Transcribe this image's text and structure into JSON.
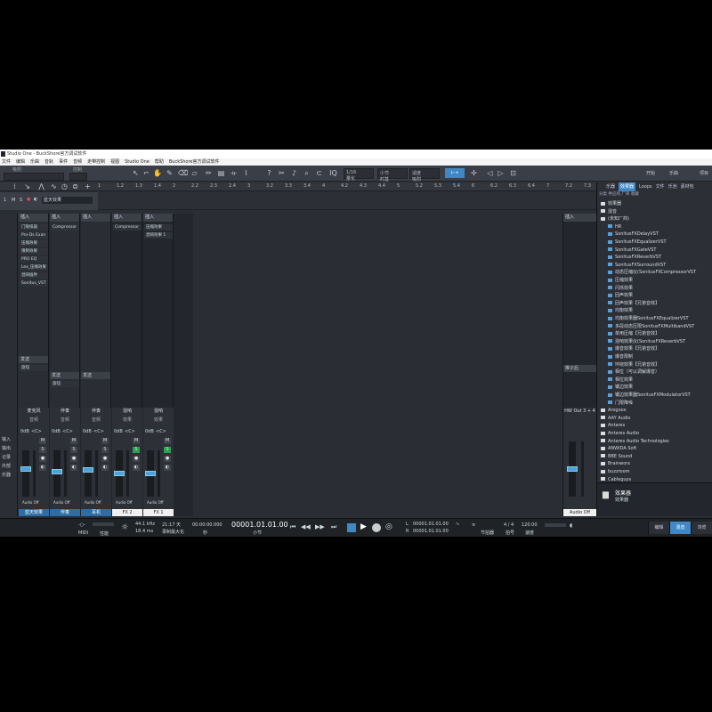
{
  "app": {
    "title": "Studio One - BuckShore官方调试软件",
    "menu": [
      "文件",
      "编辑",
      "乐曲",
      "音轨",
      "事件",
      "音频",
      "走带控制",
      "视图",
      "Studio One",
      "帮助",
      "BuckShore官方调试软件"
    ]
  },
  "toolbar": {
    "label_snap": "吸附",
    "label_control": "控制",
    "quant_value": "1/16",
    "quant_label": "量化",
    "timebase_value": "小节",
    "timebase_label": "时基",
    "snap_value": "适度",
    "snap_label": "吸附",
    "right_buttons": [
      "开始",
      "乐曲",
      "项目"
    ]
  },
  "ruler": {
    "ticks": [
      "1",
      "1.2",
      "1.3",
      "1.4",
      "2",
      "2.2",
      "2.3",
      "2.4",
      "3",
      "3.2",
      "3.3",
      "3.4",
      "4",
      "4.2",
      "4.3",
      "4.4",
      "5",
      "5.2",
      "5.3",
      "5.4",
      "6",
      "6.2",
      "6.3",
      "6.4",
      "7",
      "7.2",
      "7.3"
    ]
  },
  "track": {
    "number": "1",
    "name": "蓝天效果"
  },
  "mixer": {
    "channels": [
      {
        "header": "插入",
        "slots": [
          "门限排器",
          "Pro-Ds Exan",
          "压缩效果",
          "限制效果",
          "PRO EQ",
          "Lex_压缩效果",
          "混响插件",
          "Sonitus_VST"
        ],
        "send_header": "发送",
        "sends": [
          "旋钮"
        ],
        "label": "麦克风",
        "sublabel": "音频",
        "gain": "0dB",
        "pan": "<C>",
        "level": 0.6,
        "foot": "蓝天效果",
        "foot_selected": true,
        "input": "Audio Off"
      },
      {
        "header": "插入",
        "slots": [
          "Compressor"
        ],
        "send_header": "发送",
        "sends": [
          "旋钮"
        ],
        "label": "伴奏",
        "sublabel": "音频",
        "gain": "0dB",
        "pan": "<C>",
        "level": 0.55,
        "foot": "伴奏",
        "foot_selected": true,
        "input": "Audio Off"
      },
      {
        "header": "插入",
        "slots": [],
        "send_header": "发送",
        "sends": [],
        "label": "伴奏",
        "sublabel": "音频",
        "gain": "0dB",
        "pan": "<C>",
        "level": 0.58,
        "foot": "耳机",
        "foot_selected": true,
        "input": "Audio Off"
      },
      {
        "header": "插入",
        "slots": [
          "Compressor"
        ],
        "send_header": "",
        "sends": [],
        "label": "混响",
        "sublabel": "效果",
        "gain": "0dB",
        "pan": "<C>",
        "level": 0.5,
        "foot": "FX 2",
        "foot_selected": false,
        "input": "Audio Off"
      },
      {
        "header": "插入",
        "slots": [
          "压缩效果",
          "混响效果 1"
        ],
        "send_header": "",
        "sends": [],
        "label": "混响",
        "sublabel": "效果",
        "gain": "0dB",
        "pan": "<C>",
        "level": 0.5,
        "foot": "FX 1",
        "foot_selected": false,
        "input": "Audio Off"
      }
    ],
    "left_nav": [
      "输入",
      "输出",
      "记录",
      "外部",
      "乐器"
    ],
    "hw_header": "插入",
    "hw_send": "推子后",
    "hw_label": "HW Out 3 + 4",
    "hw_foot": "Audio Off"
  },
  "browser": {
    "tabs": [
      "乐器",
      "效果器",
      "Loops",
      "文件",
      "乐池",
      "素材包"
    ],
    "sub": "分类  供应商  厂商  收藏",
    "items": [
      {
        "t": "效果器",
        "k": "fold"
      },
      {
        "t": "混音",
        "k": "fold"
      },
      {
        "t": "(未知厂商)",
        "k": "fold"
      },
      {
        "t": "HR",
        "k": "plug"
      },
      {
        "t": "SonitusFXDelayVST",
        "k": "plug"
      },
      {
        "t": "SonitusFXEqualizerVST",
        "k": "plug"
      },
      {
        "t": "SonitusFXGateVST",
        "k": "plug"
      },
      {
        "t": "SonitusFXReverbVST",
        "k": "plug"
      },
      {
        "t": "SonitusFXSurroundVST",
        "k": "plug"
      },
      {
        "t": "动态压缩仪(SonitusFXCompressorVST",
        "k": "plug"
      },
      {
        "t": "压缩效果",
        "k": "plug"
      },
      {
        "t": "闪烁效果",
        "k": "plug"
      },
      {
        "t": "回声效果",
        "k": "plug"
      },
      {
        "t": "回声效果【兄弟音效】",
        "k": "plug"
      },
      {
        "t": "均衡效果",
        "k": "plug"
      },
      {
        "t": "均衡效果器SonitusFXEqualizerVST",
        "k": "plug"
      },
      {
        "t": "多段动态压限SonitusFXMultibandVST",
        "k": "plug"
      },
      {
        "t": "单用压缩【兄弟音效】",
        "k": "plug"
      },
      {
        "t": "混响效果仪(SonitusFXReverbVST",
        "k": "plug"
      },
      {
        "t": "爆音效果【兄弟音效】",
        "k": "plug"
      },
      {
        "t": "爆音限制",
        "k": "plug"
      },
      {
        "t": "环绕效果【兄弟音效】",
        "k": "plug"
      },
      {
        "t": "相位（可以调解爆音）",
        "k": "plug"
      },
      {
        "t": "相位效果",
        "k": "plug"
      },
      {
        "t": "镶边效果",
        "k": "plug"
      },
      {
        "t": "镶边效果器SonitusFXModulatorVST",
        "k": "plug"
      },
      {
        "t": "门限降噪",
        "k": "plug"
      },
      {
        "t": "Arogoox",
        "k": "fold"
      },
      {
        "t": "AAY Audio",
        "k": "fold"
      },
      {
        "t": "Antares",
        "k": "fold"
      },
      {
        "t": "Antares Audio",
        "k": "fold"
      },
      {
        "t": "Antares Audio Technologies",
        "k": "fold"
      },
      {
        "t": "ANWIDA Soft",
        "k": "fold"
      },
      {
        "t": "BBE Sound",
        "k": "fold"
      },
      {
        "t": "Brainworx",
        "k": "fold"
      },
      {
        "t": "buzzroom",
        "k": "fold"
      },
      {
        "t": "Cableguys",
        "k": "fold"
      },
      {
        "t": "Cakewalk",
        "k": "fold"
      }
    ],
    "footer_title": "效果器",
    "footer_sub": "效果器"
  },
  "transport": {
    "midi": "MIDI",
    "perf": "性能",
    "sample_rate": "44.1 kHz",
    "latency": "18.4 ms",
    "record_time": "21:17 天",
    "record_label": "录制最大化",
    "seconds": "00:00:00.000",
    "seconds_label": "秒",
    "bars": "00001.01.01.00",
    "bars_label": "小节",
    "loop_l": "00001.01.01.00",
    "loop_r": "00001.01.01.00",
    "metronome_label": "节拍器",
    "signature": "4 / 4",
    "signature_label": "拍号",
    "tempo": "120.00",
    "tempo_label": "速度",
    "modes": [
      "编辑",
      "混音",
      "浏览"
    ]
  }
}
